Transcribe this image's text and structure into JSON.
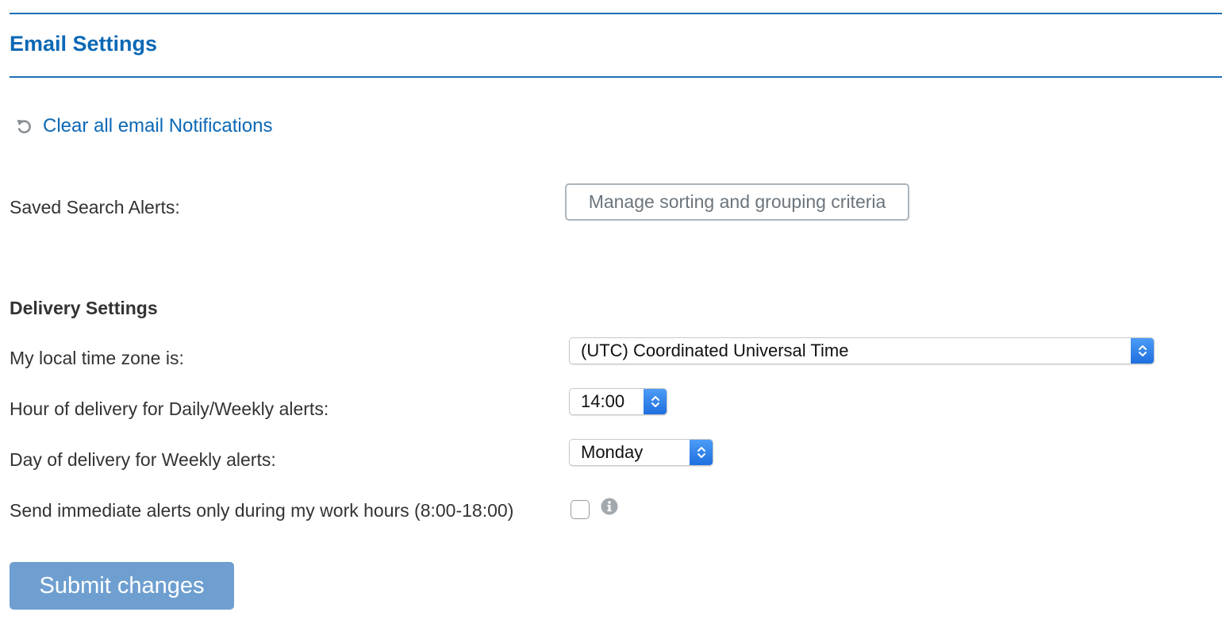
{
  "header": {
    "title": "Email Settings"
  },
  "actions": {
    "clear_label": "Clear all email Notifications",
    "clear_icon": "refresh-icon"
  },
  "saved_search": {
    "label": "Saved Search Alerts:",
    "manage_button": "Manage sorting and grouping criteria"
  },
  "delivery": {
    "heading": "Delivery Settings",
    "timezone_label": "My local time zone is:",
    "timezone_value": "(UTC) Coordinated Universal Time",
    "hour_label": "Hour of delivery for Daily/Weekly alerts:",
    "hour_value": "14:00",
    "day_label": "Day of delivery for Weekly alerts:",
    "day_value": "Monday",
    "work_hours_label": "Send immediate alerts only during my work hours (8:00-18:00)",
    "work_hours_checked": false,
    "info_icon": "info-icon"
  },
  "footer": {
    "submit_label": "Submit changes"
  },
  "colors": {
    "accent": "#0b68b5",
    "rule": "#1f6fb5",
    "submit_bg": "#6e9fd0",
    "stepper": "#2f80ea"
  }
}
